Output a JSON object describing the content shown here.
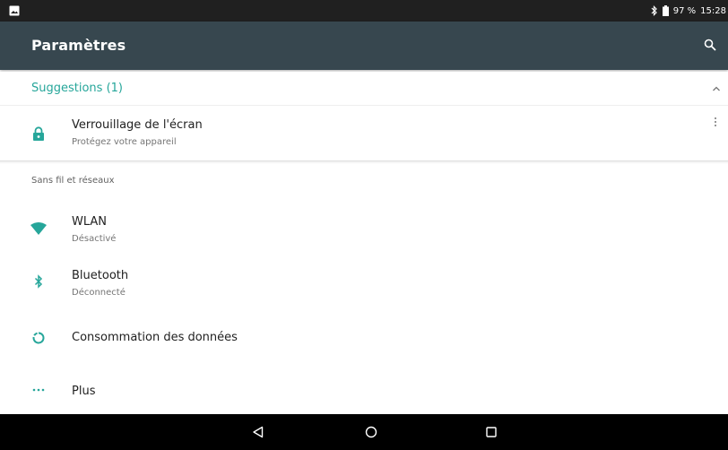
{
  "status_bar": {
    "battery": "97 %",
    "time": "15:28",
    "icons": [
      "image-notification-icon",
      "bluetooth-icon",
      "battery-icon"
    ]
  },
  "app_bar": {
    "title": "Paramètres",
    "search_icon": "search-icon"
  },
  "suggestions": {
    "header": "Suggestions (1)",
    "items": [
      {
        "title": "Verrouillage de l'écran",
        "subtitle": "Protégez votre appareil",
        "icon": "lock-icon"
      }
    ]
  },
  "sections": [
    {
      "title": "Sans fil et réseaux",
      "items": [
        {
          "title": "WLAN",
          "subtitle": "Désactivé",
          "icon": "wifi-icon"
        },
        {
          "title": "Bluetooth",
          "subtitle": "Déconnecté",
          "icon": "bluetooth-icon"
        },
        {
          "title": "Consommation des données",
          "icon": "data-usage-icon"
        },
        {
          "title": "Plus",
          "icon": "more-horizontal-icon"
        }
      ]
    }
  ],
  "nav_bar": {
    "buttons": [
      "back-icon",
      "home-icon",
      "recents-icon"
    ]
  },
  "colors": {
    "accent": "#26a69a",
    "app_bar": "#37474f",
    "status_bar": "#202020",
    "nav_bar": "#000000"
  }
}
